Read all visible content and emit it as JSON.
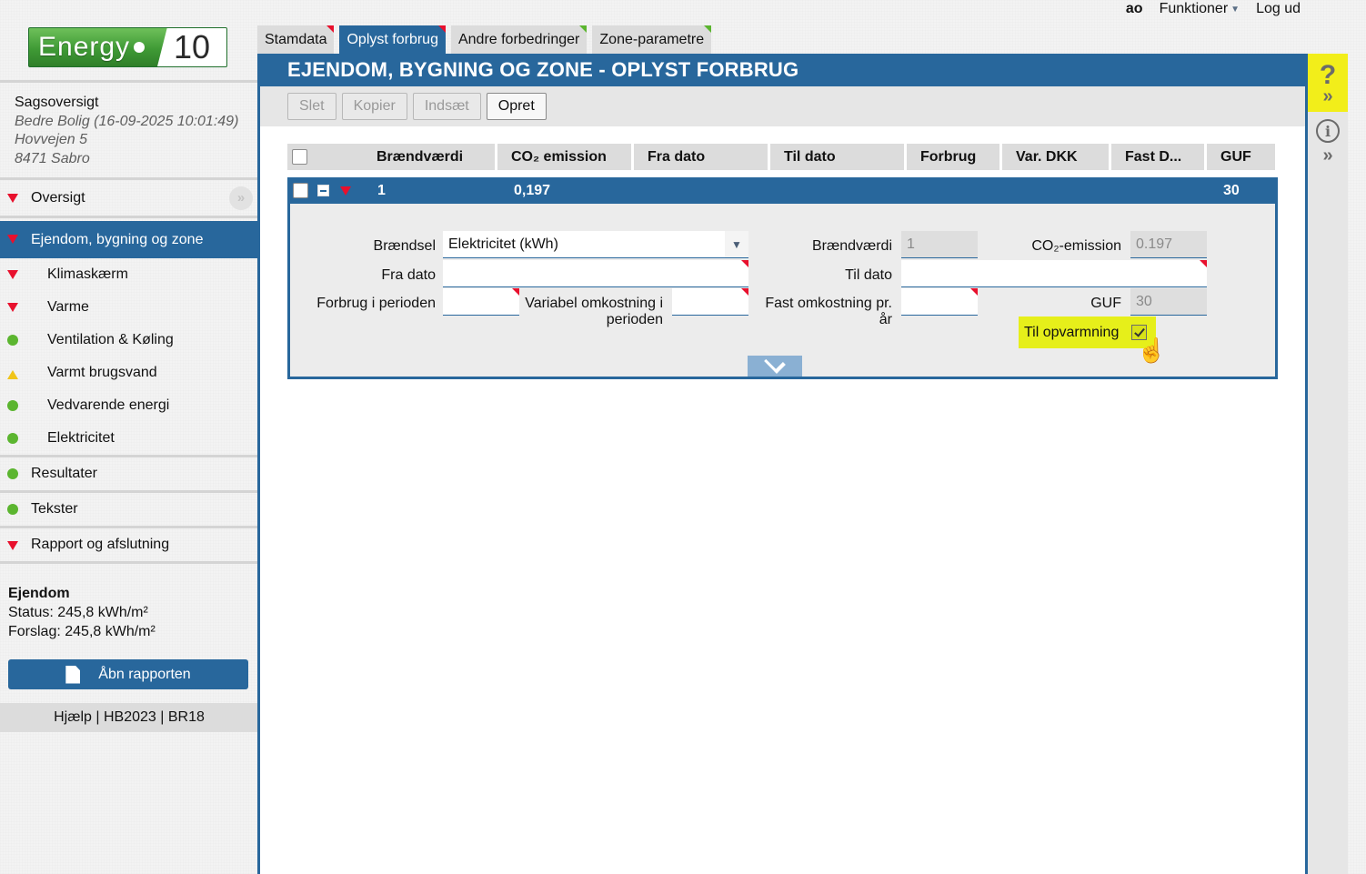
{
  "topbar": {
    "user": "ao",
    "functions": "Funktioner",
    "logout": "Log ud"
  },
  "logo": {
    "energy": "Energy",
    "ten": "10"
  },
  "case": {
    "title": "Sagsoversigt",
    "line1": "Bedre Bolig (16-09-2025 10:01:49)",
    "line2": "Hovvejen 5",
    "line3": "8471 Sabro"
  },
  "nav": {
    "oversigt": "Oversigt",
    "ejendom": "Ejendom, bygning og zone",
    "klimaskaerm": "Klimaskærm",
    "varme": "Varme",
    "ventilation": "Ventilation & Køling",
    "varmt": "Varmt brugsvand",
    "vedvarende": "Vedvarende energi",
    "elektricitet": "Elektricitet",
    "resultater": "Resultater",
    "tekster": "Tekster",
    "rapport": "Rapport og afslutning"
  },
  "summary": {
    "heading": "Ejendom",
    "status": "Status: 245,8 kWh/m²",
    "forslag": "Forslag: 245,8 kWh/m²"
  },
  "open_report": "Åbn rapporten",
  "footer": {
    "help": "Hjælp",
    "hb": "HB2023",
    "br": "BR18",
    "sep": " | "
  },
  "tabs": [
    "Stamdata",
    "Oplyst forbrug",
    "Andre forbedringer",
    "Zone-parametre"
  ],
  "panel_title": "EJENDOM, BYGNING OG ZONE - OPLYST FORBRUG",
  "toolbar": {
    "delete": "Slet",
    "copy": "Kopier",
    "paste": "Indsæt",
    "create": "Opret"
  },
  "grid": {
    "headers": [
      "Brændværdi",
      "CO₂ emission",
      "Fra dato",
      "Til dato",
      "Forbrug",
      "Var. DKK",
      "Fast D...",
      "GUF"
    ],
    "row": {
      "braendvaerdi": "1",
      "co2": "0,197",
      "guf": "30"
    }
  },
  "form": {
    "braendsel_label": "Brændsel",
    "braendsel_value": "Elektricitet (kWh)",
    "fra_dato_label": "Fra dato",
    "fra_dato_value": "",
    "forbrug_label": "Forbrug i perioden",
    "forbrug_value": "",
    "variabel_label_1": "Variabel omkostning i",
    "variabel_label_2": "perioden",
    "variabel_value": "",
    "braendvaerdi_label": "Brændværdi",
    "braendvaerdi_value": "1",
    "til_dato_label": "Til dato",
    "til_dato_value": "",
    "fast_label_1": "Fast omkostning pr.",
    "fast_label_2": "år",
    "fast_value": "",
    "co2_label": "CO₂-emission",
    "co2_value": "0.197",
    "guf_label": "GUF",
    "guf_value": "30",
    "til_opvarmning_label": "Til opvarmning",
    "til_opvarmning_checked": true
  }
}
